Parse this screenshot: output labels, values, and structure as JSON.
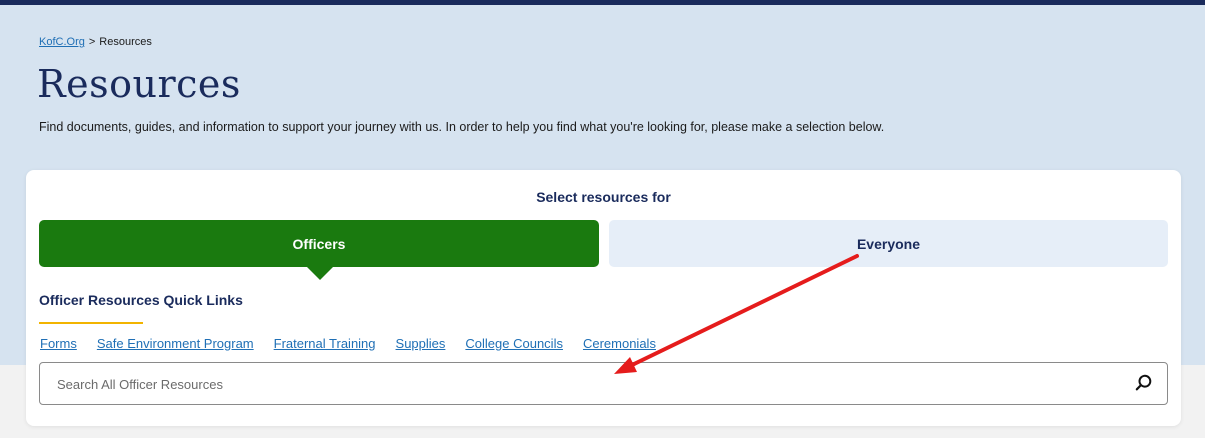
{
  "breadcrumb": {
    "home": "KofC.Org",
    "separator": ">",
    "current": "Resources"
  },
  "page": {
    "title": "Resources",
    "intro": "Find documents, guides, and information to support your journey with us. In order to help you find what you're looking for, please make a selection below."
  },
  "selector": {
    "label": "Select resources for",
    "tabs": [
      {
        "label": "Officers",
        "active": true
      },
      {
        "label": "Everyone",
        "active": false
      }
    ]
  },
  "quick_links": {
    "title": "Officer Resources Quick Links",
    "items": [
      {
        "label": "Forms"
      },
      {
        "label": "Safe Environment Program"
      },
      {
        "label": "Fraternal Training"
      },
      {
        "label": "Supplies"
      },
      {
        "label": "College Councils"
      },
      {
        "label": "Ceremonials"
      }
    ]
  },
  "search": {
    "placeholder": "Search All Officer Resources",
    "value": ""
  },
  "colors": {
    "brand_navy": "#1a2b5c",
    "active_green": "#1a7a0f",
    "hero_background": "#d6e3f0",
    "link_blue": "#1f6fb5",
    "accent_gold": "#f2b400",
    "annotation_red": "#e51c1c"
  },
  "icons": {
    "search": "search-icon"
  }
}
